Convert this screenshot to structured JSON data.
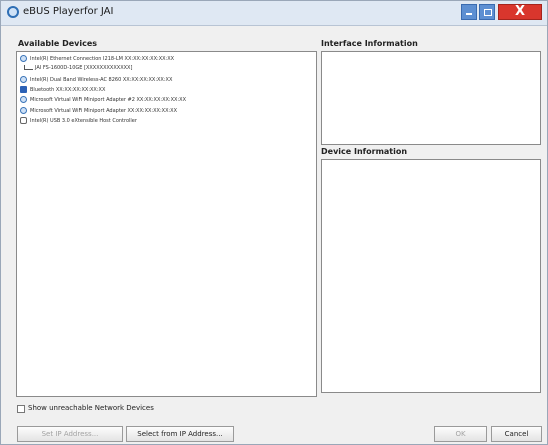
{
  "window": {
    "title": "eBUS Playerfor JAI",
    "close_label": "X"
  },
  "available_devices": {
    "title": "Available Devices",
    "items": [
      {
        "label": "Intel(R) Ethernet Connection I218-LM XX:XX:XX:XX:XX:XX",
        "icon": "network-adapter-icon"
      },
      {
        "label": "JAI FS-1600D-10GE [XXXXXXXXXXXXX]",
        "icon": "camera-child-icon"
      },
      {
        "label": "Intel(R) Dual Band Wireless-AC 8260 XX:XX:XX:XX:XX:XX",
        "icon": "network-adapter-icon"
      },
      {
        "label": "Bluetooth XX:XX:XX:XX:XX:XX",
        "icon": "bluetooth-icon"
      },
      {
        "label": "Microsoft Virtual WiFi Miniport Adapter #2 XX:XX:XX:XX:XX:XX",
        "icon": "network-adapter-icon"
      },
      {
        "label": "Microsoft Virtual WiFi Miniport Adapter XX:XX:XX:XX:XX:XX",
        "icon": "network-adapter-icon"
      },
      {
        "label": "Intel(R) USB 3.0 eXtensible Host Controller",
        "icon": "usb-icon"
      }
    ]
  },
  "interface_information": {
    "title": "Interface Information"
  },
  "device_information": {
    "title": "Device Information"
  },
  "show_unreachable": {
    "label": "Show unreachable Network Devices",
    "checked": false
  },
  "buttons": {
    "set_ip": "Set IP Address...",
    "select_ip": "Select from IP Address...",
    "ok": "OK",
    "cancel": "Cancel"
  }
}
